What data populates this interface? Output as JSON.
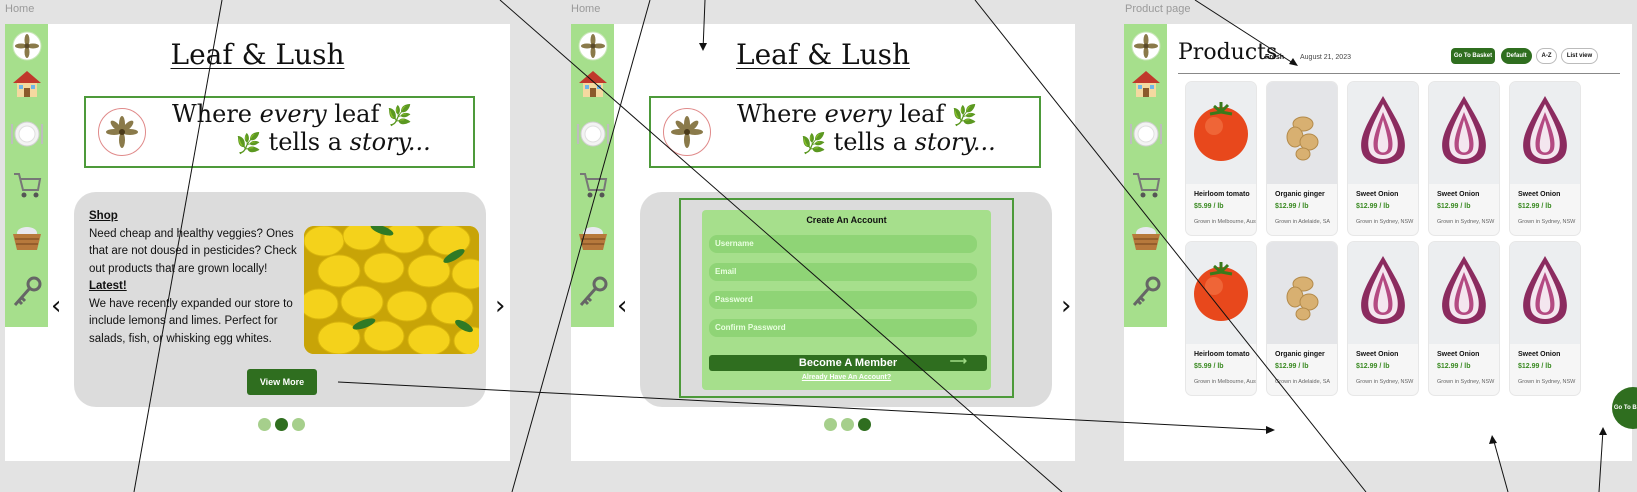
{
  "frames": {
    "home1_label": "Home",
    "home2_label": "Home",
    "product_label": "Product page"
  },
  "brand": {
    "title": "Leaf & Lush",
    "tagline_part1": "Where ",
    "tagline_em1": "every",
    "tagline_part2": " leaf",
    "tagline_part3": "tells a ",
    "tagline_em2": "story...",
    "logo_icon": "lotus-logo-icon"
  },
  "sidebar": {
    "items": [
      {
        "icon": "lotus-logo-icon"
      },
      {
        "icon": "house-icon"
      },
      {
        "icon": "plate-icon"
      },
      {
        "icon": "shopping-cart-icon"
      },
      {
        "icon": "basket-icon"
      },
      {
        "icon": "key-icon"
      }
    ]
  },
  "home": {
    "shop_heading": "Shop",
    "shop_text": "Need cheap and healthy veggies? Ones that are not doused in pesticides? Check out products that are grown locally!",
    "latest_heading": "Latest!",
    "latest_text": "We have recently expanded our store to include lemons and limes. Perfect for salads, fish, or whisking egg whites.",
    "view_more": "View More",
    "image_icon": "lemons-photo"
  },
  "signup": {
    "title": "Create An Account",
    "username_placeholder": "Username",
    "email_placeholder": "Email",
    "password_placeholder": "Password",
    "confirm_placeholder": "Confirm Password",
    "submit_label": "Become A Member",
    "already_link": "Already Have An Account?"
  },
  "products": {
    "title": "Products",
    "subtitle_fresh": "Fresh",
    "date": "August 21, 2023",
    "btn_basket": "Go To Basket",
    "btn_default": "Default",
    "btn_az": "A-Z",
    "btn_list": "List view",
    "floating_basket": "Go To Basket",
    "items": [
      {
        "name": "Heirloom tomato",
        "price": "$5.99 / lb",
        "origin": "Grown in Melbourne, Australia",
        "img": "tomato"
      },
      {
        "name": "Organic ginger",
        "price": "$12.99 / lb",
        "origin": "Grown in Adelaide, SA",
        "img": "ginger"
      },
      {
        "name": "Sweet Onion",
        "price": "$12.99 / lb",
        "origin": "Grown in Sydney, NSW",
        "img": "onion"
      },
      {
        "name": "Sweet Onion",
        "price": "$12.99 / lb",
        "origin": "Grown in Sydney, NSW",
        "img": "onion"
      },
      {
        "name": "Sweet Onion",
        "price": "$12.99 / lb",
        "origin": "Grown in Sydney, NSW",
        "img": "onion"
      },
      {
        "name": "Heirloom tomato",
        "price": "$5.99 / lb",
        "origin": "Grown in Melbourne, Australia",
        "img": "tomato"
      },
      {
        "name": "Organic ginger",
        "price": "$12.99 / lb",
        "origin": "Grown in Adelaide, SA",
        "img": "ginger"
      },
      {
        "name": "Sweet Onion",
        "price": "$12.99 / lb",
        "origin": "Grown in Sydney, NSW",
        "img": "onion"
      },
      {
        "name": "Sweet Onion",
        "price": "$12.99 / lb",
        "origin": "Grown in Sydney, NSW",
        "img": "onion"
      },
      {
        "name": "Sweet Onion",
        "price": "$12.99 / lb",
        "origin": "Grown in Sydney, NSW",
        "img": "onion"
      }
    ]
  },
  "carousel": {
    "prev_icon": "chevron-left-icon",
    "next_icon": "chevron-right-icon"
  },
  "colors": {
    "accent_green": "#2f6e1f",
    "sidebar_green": "#a6df8c",
    "border_green": "#4d9a3a",
    "card_gray": "#dcdcdc"
  }
}
